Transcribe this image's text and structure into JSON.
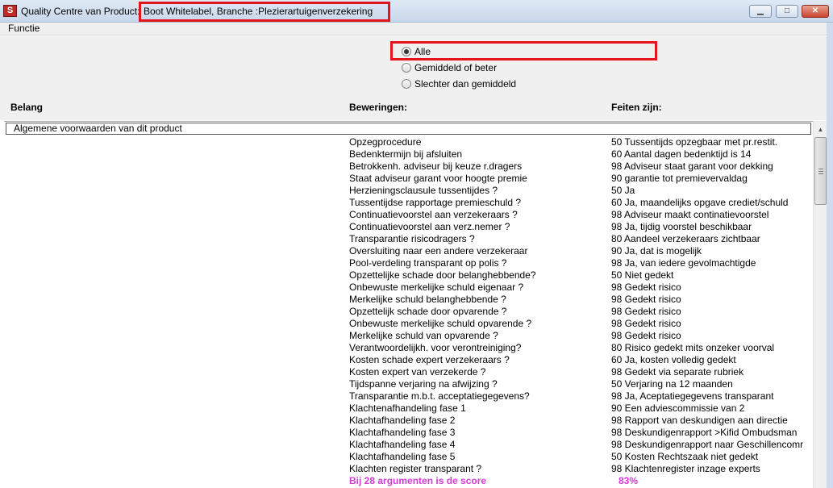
{
  "window": {
    "app_title": "Quality Centre  van Product:",
    "product_title": "Boot Whitelabel, Branche :Plezierartuigenverzekering",
    "app_icon_letter": "S"
  },
  "menu": {
    "functie": "Functie"
  },
  "filter": {
    "options": [
      {
        "label": "Alle",
        "selected": true
      },
      {
        "label": "Gemiddeld of beter",
        "selected": false
      },
      {
        "label": "Slechter dan gemiddeld",
        "selected": false
      }
    ]
  },
  "columns": {
    "belang": "Belang",
    "beweringen": "Beweringen:",
    "feiten": "Feiten zijn:"
  },
  "group": "Algemene voorwaarden van dit product",
  "rows": [
    {
      "claim": "Opzegprocedure",
      "fact": "50 Tussentijds opzegbaar met pr.restit."
    },
    {
      "claim": "Bedenktermijn bij afsluiten",
      "fact": "60 Aantal dagen bedenktijd is 14"
    },
    {
      "claim": "Betrokkenh. adviseur bij keuze r.dragers",
      "fact": "98 Adviseur staat garant voor dekking"
    },
    {
      "claim": "Staat adviseur garant voor hoogte premie",
      "fact": "90  garantie tot premievervaldag"
    },
    {
      "claim": "Herzieningsclausule tussentijdes ?",
      "fact": "50 Ja"
    },
    {
      "claim": "Tussentijdse rapportage premieschuld ?",
      "fact": "60 Ja, maandelijks opgave crediet/schuld"
    },
    {
      "claim": "Continuatievoorstel aan verzekeraars ?",
      "fact": "98 Adviseur maakt continatievoorstel"
    },
    {
      "claim": "Continuatievoorstel aan verz.nemer ?",
      "fact": "98 Ja, tijdig voorstel beschikbaar"
    },
    {
      "claim": "Transparantie risicodragers ?",
      "fact": "80 Aandeel verzekeraars zichtbaar"
    },
    {
      "claim": "Oversluiting naar een andere verzekeraar",
      "fact": "90 Ja, dat is mogelijk"
    },
    {
      "claim": "Pool-verdeling transparant op polis ?",
      "fact": "98 Ja, van iedere gevolmachtigde"
    },
    {
      "claim": "Opzettelijke schade door belanghebbende?",
      "fact": "50 Niet gedekt"
    },
    {
      "claim": "Onbewuste merkelijke schuld eigenaar ?",
      "fact": "98 Gedekt risico"
    },
    {
      "claim": "Merkelijke schuld belanghebbende ?",
      "fact": "98 Gedekt risico"
    },
    {
      "claim": "Opzettelijk schade door opvarende ?",
      "fact": "98 Gedekt risico"
    },
    {
      "claim": "Onbewuste merkelijke schuld opvarende ?",
      "fact": "98 Gedekt risico"
    },
    {
      "claim": "Merkelijke schuld van opvarende ?",
      "fact": "98 Gedekt risico"
    },
    {
      "claim": "Verantwoordelijkh. voor verontreiniging?",
      "fact": "80 Risico gedekt mits onzeker voorval"
    },
    {
      "claim": "Kosten schade expert verzekeraars ?",
      "fact": "60 Ja, kosten volledig gedekt"
    },
    {
      "claim": "Kosten expert van verzekerde ?",
      "fact": "98 Gedekt via separate rubriek"
    },
    {
      "claim": "Tijdspanne verjaring na afwijzing ?",
      "fact": "50 Verjaring na 12 maanden"
    },
    {
      "claim": "Transparantie m.b.t. acceptatiegegevens?",
      "fact": "98 Ja, Aceptatiegegevens transparant"
    },
    {
      "claim": "Klachtenafhandeling fase 1",
      "fact": "90 Een adviescommissie van 2"
    },
    {
      "claim": "Klachtafhandeling fase 2",
      "fact": "98 Rapport van deskundigen aan directie"
    },
    {
      "claim": "Klachtafhandeling fase 3",
      "fact": "98 Deskundigenrapport >Kifid Ombudsman"
    },
    {
      "claim": "Klachtafhandeling fase 4",
      "fact": "98 Deskundigenrapport naar Geschillencomr"
    },
    {
      "claim": "Klachtafhandeling fase 5",
      "fact": "50 Kosten Rechtszaak niet gedekt"
    },
    {
      "claim": "Klachten register transparant ?",
      "fact": "98 Klachtenregister inzage experts"
    }
  ],
  "score": {
    "label": "Bij     28 argumenten is de score",
    "value": "83%"
  },
  "colors": {
    "highlight": "#e3141c",
    "score": "#d63ad6"
  }
}
